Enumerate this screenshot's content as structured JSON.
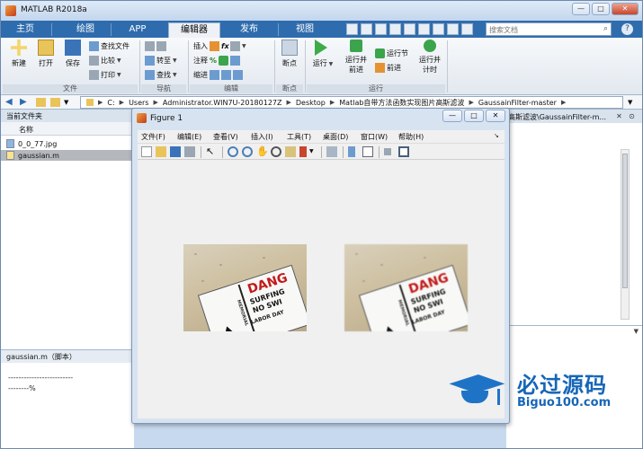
{
  "window": {
    "title": "MATLAB R2018a"
  },
  "tabs": [
    "主页",
    "绘图",
    "APP",
    "编辑器",
    "发布",
    "视图"
  ],
  "search": {
    "placeholder": "搜索文档"
  },
  "ribbon": {
    "file": {
      "new": "新建",
      "open": "打开",
      "save": "保存",
      "find_files": "查找文件",
      "compare": "比较",
      "print": "打印",
      "section": "文件"
    },
    "navigate": {
      "goto": "转至",
      "find": "查找",
      "section": "导航"
    },
    "edit": {
      "insert": "插入",
      "comment": "注释",
      "indent": "缩进",
      "fx": "fx",
      "section": "编辑"
    },
    "breakpoints": {
      "label": "断点",
      "section": "断点"
    },
    "run": {
      "run": "运行",
      "run_advance_1": "运行并",
      "run_advance_2": "前进",
      "run_section": "运行节",
      "advance": "前进",
      "run_time_1": "运行并",
      "run_time_2": "计时",
      "section": "运行"
    }
  },
  "path": [
    "C:",
    "Users",
    "Administrator.WIN7U-20180127Z",
    "Desktop",
    "Matlab自带方法函数实现图片高斯滤波",
    "GaussainFilter-master"
  ],
  "current_folder": {
    "header": "当前文件夹",
    "column": "名称",
    "files": [
      {
        "name": "0_0_77.jpg",
        "type": "jpg"
      },
      {
        "name": "gaussian.m",
        "type": "m"
      }
    ]
  },
  "details": {
    "header": "gaussian.m（脚本）",
    "line1": "-------------------------",
    "line2": "--------%"
  },
  "editor": {
    "title_fragment": "高斯滤波\\GaussainFilter-m..."
  },
  "figure": {
    "title": "Figure 1",
    "menu": [
      "文件(F)",
      "编辑(E)",
      "查看(V)",
      "插入(I)",
      "工具(T)",
      "桌面(D)",
      "窗口(W)",
      "帮助(H)"
    ],
    "images": [
      {
        "label_top": "DANG",
        "line2": "SURFING",
        "line3": "NO SWI",
        "side": "MEMORIAL",
        "bottom": "LABOR DAY"
      },
      {
        "label_top": "DANG",
        "line2": "SURFING",
        "line3": "NO SWI",
        "side": "MEMORIAL",
        "bottom": "LABOR DAY"
      }
    ]
  },
  "watermark": {
    "line1": "必过源码",
    "line2": "Biguo100.com"
  }
}
